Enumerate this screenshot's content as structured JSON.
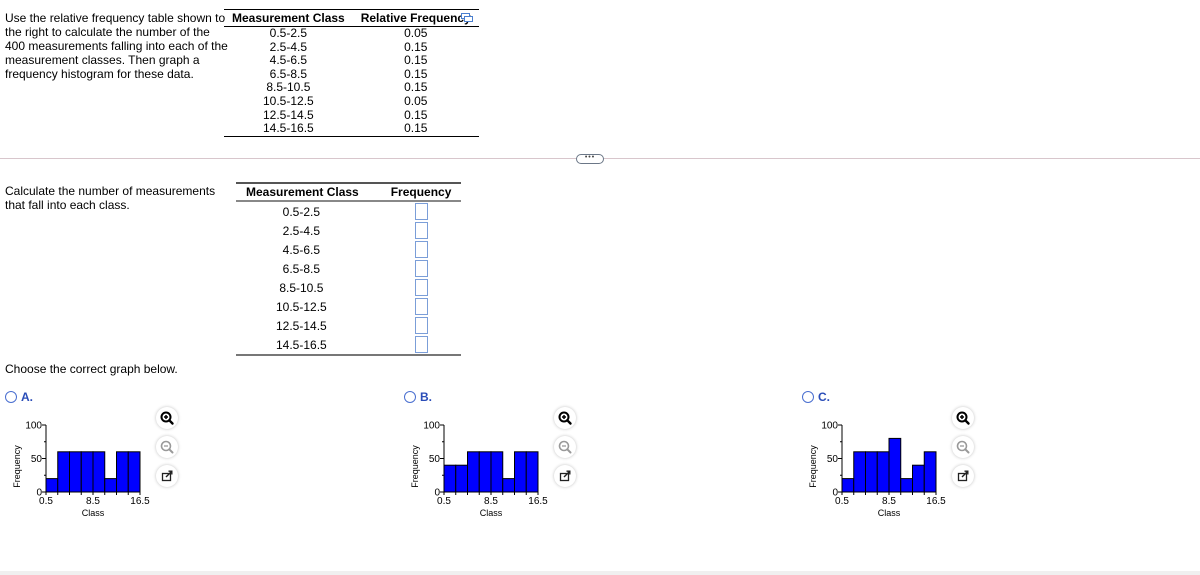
{
  "intro_text": [
    "Use the relative frequency table shown to",
    "the right to calculate the number of the",
    "400 measurements falling into each of the",
    "measurement classes. Then graph a",
    "frequency histogram for these data."
  ],
  "rel_table": {
    "headers": [
      "Measurement Class",
      "Relative Frequency"
    ],
    "rows": [
      [
        "0.5-2.5",
        "0.05"
      ],
      [
        "2.5-4.5",
        "0.15"
      ],
      [
        "4.5-6.5",
        "0.15"
      ],
      [
        "6.5-8.5",
        "0.15"
      ],
      [
        "8.5-10.5",
        "0.15"
      ],
      [
        "10.5-12.5",
        "0.05"
      ],
      [
        "12.5-14.5",
        "0.15"
      ],
      [
        "14.5-16.5",
        "0.15"
      ]
    ]
  },
  "more_button_label": "•••",
  "calc_text": [
    "Calculate the number of measurements",
    "that fall into each class."
  ],
  "freq_table": {
    "headers": [
      "Measurement Class",
      "Frequency"
    ],
    "rows": [
      {
        "cls": "0.5-2.5",
        "value": ""
      },
      {
        "cls": "2.5-4.5",
        "value": ""
      },
      {
        "cls": "4.5-6.5",
        "value": ""
      },
      {
        "cls": "6.5-8.5",
        "value": ""
      },
      {
        "cls": "8.5-10.5",
        "value": ""
      },
      {
        "cls": "10.5-12.5",
        "value": ""
      },
      {
        "cls": "12.5-14.5",
        "value": ""
      },
      {
        "cls": "14.5-16.5",
        "value": ""
      }
    ]
  },
  "choose_text": "Choose the correct graph below.",
  "options": [
    {
      "label": "A.",
      "selected": false
    },
    {
      "label": "B.",
      "selected": false
    },
    {
      "label": "C.",
      "selected": false
    }
  ],
  "colors": {
    "bar_fill": "#0000ff",
    "option_label": "#2a4db8",
    "input_border": "#7b9ed8"
  },
  "chart_data": [
    {
      "type": "bar",
      "title": "",
      "xlabel": "Class",
      "ylabel": "Frequency",
      "ylim": [
        0,
        100
      ],
      "xlim": [
        0.5,
        16.5
      ],
      "xticks": [
        "0.5",
        "8.5",
        "16.5"
      ],
      "yticks": [
        "0",
        "50",
        "100"
      ],
      "bins": [
        0.5,
        2.5,
        4.5,
        6.5,
        8.5,
        10.5,
        12.5,
        14.5,
        16.5
      ],
      "values": [
        20,
        60,
        60,
        60,
        60,
        20,
        60,
        60
      ]
    },
    {
      "type": "bar",
      "title": "",
      "xlabel": "Class",
      "ylabel": "Frequency",
      "ylim": [
        0,
        100
      ],
      "xlim": [
        0.5,
        16.5
      ],
      "xticks": [
        "0.5",
        "8.5",
        "16.5"
      ],
      "yticks": [
        "0",
        "50",
        "100"
      ],
      "bins": [
        0.5,
        2.5,
        4.5,
        6.5,
        8.5,
        10.5,
        12.5,
        14.5,
        16.5
      ],
      "values": [
        40,
        40,
        60,
        60,
        60,
        20,
        60,
        60
      ]
    },
    {
      "type": "bar",
      "title": "",
      "xlabel": "Class",
      "ylabel": "Frequency",
      "ylim": [
        0,
        100
      ],
      "xlim": [
        0.5,
        16.5
      ],
      "xticks": [
        "0.5",
        "8.5",
        "16.5"
      ],
      "yticks": [
        "0",
        "50",
        "100"
      ],
      "bins": [
        0.5,
        2.5,
        4.5,
        6.5,
        8.5,
        10.5,
        12.5,
        14.5,
        16.5
      ],
      "values": [
        20,
        60,
        60,
        60,
        80,
        20,
        40,
        60
      ]
    }
  ],
  "icons": {
    "zoom_in": "zoom-in-icon",
    "zoom_out": "zoom-out-icon",
    "popout": "popout-icon",
    "copy": "copy-table-icon"
  }
}
